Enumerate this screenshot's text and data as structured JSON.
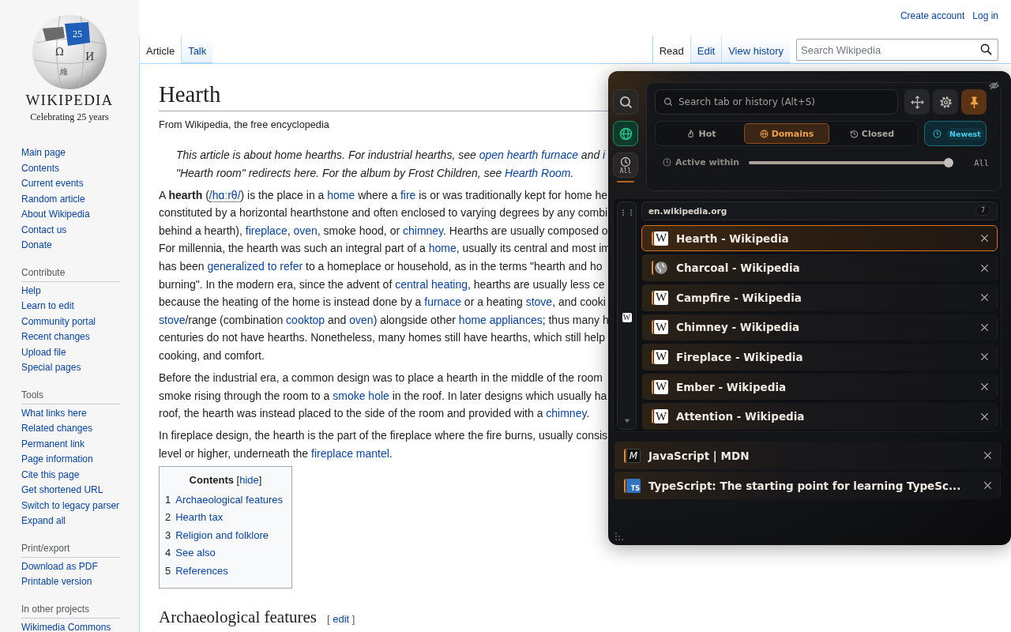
{
  "header": {
    "links": [
      "Create account",
      "Log in"
    ]
  },
  "logo": {
    "badge": "25",
    "glyphs": [
      "Ω",
      "И",
      "維"
    ],
    "wordmark": "WIKIPEDIA",
    "tagline": "Celebrating 25 years"
  },
  "sidebar": [
    {
      "items": [
        "Main page",
        "Contents",
        "Current events",
        "Random article",
        "About Wikipedia",
        "Contact us",
        "Donate"
      ]
    },
    {
      "heading": "Contribute",
      "items": [
        "Help",
        "Learn to edit",
        "Community portal",
        "Recent changes",
        "Upload file",
        "Special pages"
      ]
    },
    {
      "heading": "Tools",
      "items": [
        "What links here",
        "Related changes",
        "Permanent link",
        "Page information",
        "Cite this page",
        "Get shortened URL",
        "Switch to legacy parser",
        "Expand all"
      ]
    },
    {
      "heading": "Print/export",
      "items": [
        "Download as PDF",
        "Printable version"
      ]
    },
    {
      "heading": "In other projects",
      "items": [
        "Wikimedia Commons"
      ]
    }
  ],
  "page_tabs": [
    {
      "label": "Article",
      "selected": true
    },
    {
      "label": "Talk",
      "selected": false
    }
  ],
  "view_tabs": [
    {
      "label": "Read",
      "selected": true
    },
    {
      "label": "Edit",
      "selected": false
    },
    {
      "label": "View history",
      "selected": false
    }
  ],
  "search": {
    "placeholder": "Search Wikipedia"
  },
  "article": {
    "title": "Hearth",
    "tagline": "From Wikipedia, the free encyclopedia",
    "hatnote": [
      [
        {
          "kind": "text",
          "text": "This article is about home hearths. For industrial hearths, see "
        },
        {
          "kind": "link",
          "text": "open hearth furnace"
        },
        {
          "kind": "text",
          "text": " and "
        },
        {
          "kind": "link",
          "text": "i"
        }
      ],
      [
        {
          "kind": "text",
          "text": "\"Hearth room\" redirects here. For the album by Frost Children, see "
        },
        {
          "kind": "link",
          "text": "Hearth Room"
        },
        {
          "kind": "text",
          "text": "."
        }
      ]
    ],
    "paragraphs": [
      [
        [
          {
            "kind": "text",
            "text": "A "
          },
          {
            "kind": "bold",
            "text": "hearth"
          },
          {
            "kind": "text",
            "text": " ("
          },
          {
            "kind": "ipa",
            "text": "/hɑːrθ/"
          },
          {
            "kind": "text",
            "text": ") is the place in a "
          },
          {
            "kind": "link",
            "text": "home"
          },
          {
            "kind": "text",
            "text": " where a "
          },
          {
            "kind": "link",
            "text": "fire"
          },
          {
            "kind": "text",
            "text": " is or was traditionally kept for home he"
          }
        ],
        [
          {
            "kind": "text",
            "text": "constituted by a horizontal hearthstone and often enclosed to varying degrees by any combi"
          }
        ],
        [
          {
            "kind": "text",
            "text": "behind a hearth), "
          },
          {
            "kind": "link",
            "text": "fireplace"
          },
          {
            "kind": "text",
            "text": ", "
          },
          {
            "kind": "link",
            "text": "oven"
          },
          {
            "kind": "text",
            "text": ", smoke hood, or "
          },
          {
            "kind": "link",
            "text": "chimney"
          },
          {
            "kind": "text",
            "text": ". Hearths are usually composed o"
          }
        ],
        [
          {
            "kind": "text",
            "text": "For millennia, the hearth was such an integral part of a "
          },
          {
            "kind": "link",
            "text": "home"
          },
          {
            "kind": "text",
            "text": ", usually its central and most im"
          }
        ],
        [
          {
            "kind": "text",
            "text": "has been "
          },
          {
            "kind": "link",
            "text": "generalized to refer"
          },
          {
            "kind": "text",
            "text": " to a homeplace or household, as in the terms \"hearth and ho"
          }
        ],
        [
          {
            "kind": "text",
            "text": "burning\". In the modern era, since the advent of "
          },
          {
            "kind": "link",
            "text": "central heating"
          },
          {
            "kind": "text",
            "text": ", hearths are usually less ce"
          }
        ],
        [
          {
            "kind": "text",
            "text": "because the heating of the home is instead done by a "
          },
          {
            "kind": "link",
            "text": "furnace"
          },
          {
            "kind": "text",
            "text": " or a heating "
          },
          {
            "kind": "link",
            "text": "stove"
          },
          {
            "kind": "text",
            "text": ", and cooki"
          }
        ],
        [
          {
            "kind": "link",
            "text": "stove"
          },
          {
            "kind": "text",
            "text": "/range (combination "
          },
          {
            "kind": "link",
            "text": "cooktop"
          },
          {
            "kind": "text",
            "text": " and "
          },
          {
            "kind": "link",
            "text": "oven"
          },
          {
            "kind": "text",
            "text": ") alongside other "
          },
          {
            "kind": "link",
            "text": "home appliances"
          },
          {
            "kind": "text",
            "text": "; thus many h"
          }
        ],
        [
          {
            "kind": "text",
            "text": "centuries do not have hearths. Nonetheless, many homes still have hearths, which still help"
          }
        ],
        [
          {
            "kind": "text",
            "text": "cooking, and comfort."
          }
        ]
      ],
      [
        [
          {
            "kind": "text",
            "text": "Before the industrial era, a common design was to place a hearth in the middle of the room"
          }
        ],
        [
          {
            "kind": "text",
            "text": "smoke rising through the room to a "
          },
          {
            "kind": "link",
            "text": "smoke hole"
          },
          {
            "kind": "text",
            "text": " in the roof. In later designs which usually ha"
          }
        ],
        [
          {
            "kind": "text",
            "text": "roof, the hearth was instead placed to the side of the room and provided with a "
          },
          {
            "kind": "link",
            "text": "chimney"
          },
          {
            "kind": "text",
            "text": "."
          }
        ]
      ],
      [
        [
          {
            "kind": "text",
            "text": "In fireplace design, the hearth is the part of the fireplace where the fire burns, usually consis"
          }
        ],
        [
          {
            "kind": "text",
            "text": "level or higher, underneath the "
          },
          {
            "kind": "link",
            "text": "fireplace mantel"
          },
          {
            "kind": "text",
            "text": "."
          }
        ]
      ]
    ],
    "toc": {
      "title": "Contents",
      "toggle_before": "[",
      "toggle": "hide",
      "toggle_after": "]",
      "items": [
        {
          "number": "1",
          "label": "Archaeological features"
        },
        {
          "number": "2",
          "label": "Hearth tax"
        },
        {
          "number": "3",
          "label": "Religion and folklore"
        },
        {
          "number": "4",
          "label": "See also"
        },
        {
          "number": "5",
          "label": "References"
        }
      ]
    },
    "section": {
      "title": "Archaeological features",
      "edit_before": "[",
      "edit": "edit",
      "edit_after": "]"
    }
  },
  "switcher": {
    "rail": [
      {
        "kind": "search",
        "selected": false
      },
      {
        "kind": "globe",
        "selected": true
      },
      {
        "kind": "clock",
        "label": "All",
        "selected": false
      }
    ],
    "search": {
      "placeholder": "Search tab or history (Alt+S)"
    },
    "tools": [
      {
        "kind": "move",
        "on": false
      },
      {
        "kind": "gear",
        "on": false
      },
      {
        "kind": "pin",
        "on": true
      }
    ],
    "modes": [
      {
        "label": "Hot",
        "kind": "flame",
        "selected": false
      },
      {
        "label": "Domains",
        "kind": "globe",
        "selected": true
      },
      {
        "label": "Closed",
        "kind": "history",
        "selected": false
      }
    ],
    "sort": {
      "label": "Newest",
      "on": true
    },
    "filter": {
      "label": "Active within",
      "level": 0.98,
      "reading": "All"
    },
    "group": {
      "domain": "en.wikipedia.org",
      "count": "7",
      "favicon": {
        "kind": "wiki",
        "text": "W"
      },
      "expanded": true,
      "tabs": [
        {
          "title": "Hearth - Wikipedia",
          "favicon": {
            "kind": "wiki",
            "text": "W"
          },
          "selected": true
        },
        {
          "title": "Charcoal - Wikipedia",
          "favicon": {
            "kind": "globe"
          },
          "selected": false
        },
        {
          "title": "Campfire - Wikipedia",
          "favicon": {
            "kind": "wiki",
            "text": "W"
          },
          "selected": false
        },
        {
          "title": "Chimney - Wikipedia",
          "favicon": {
            "kind": "wiki",
            "text": "W"
          },
          "selected": false
        },
        {
          "title": "Fireplace - Wikipedia",
          "favicon": {
            "kind": "wiki",
            "text": "W"
          },
          "selected": false
        },
        {
          "title": "Ember - Wikipedia",
          "favicon": {
            "kind": "wiki",
            "text": "W"
          },
          "selected": false
        },
        {
          "title": "Attention - Wikipedia",
          "favicon": {
            "kind": "wiki",
            "text": "W"
          },
          "selected": false
        }
      ]
    },
    "tabs": [
      {
        "title": "JavaScript | MDN",
        "favicon": {
          "kind": "mdn",
          "text": "M"
        },
        "selected": false
      },
      {
        "title": "TypeScript: The starting point for learning TypeSc...",
        "favicon": {
          "kind": "ts",
          "text": "TS"
        },
        "selected": false
      }
    ]
  }
}
